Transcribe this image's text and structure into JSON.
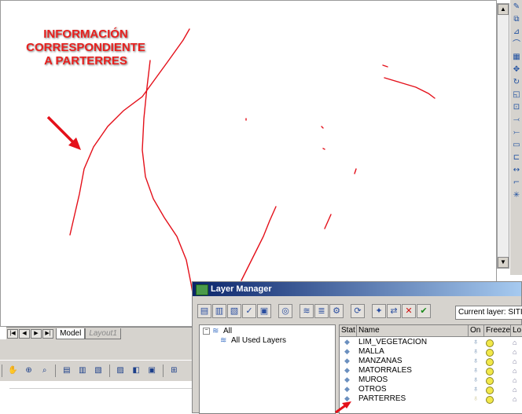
{
  "annotation": {
    "line1": "INFORMACIÓN",
    "line2": "CORRESPONDIENTE",
    "line3": "A PARTERRES",
    "color": "#e8201e"
  },
  "scrollbar": {
    "up_glyph": "▲",
    "down_glyph": "▼"
  },
  "right_toolbar": {
    "icons": [
      "erase-icon",
      "copy-icon",
      "mirror-icon",
      "offset-icon",
      "array-icon",
      "move-icon",
      "rotate-icon",
      "scale-icon",
      "stretch-icon",
      "trim-icon",
      "extend-icon",
      "break-icon",
      "join-icon",
      "chamfer-icon",
      "fillet-icon",
      "explode-icon"
    ]
  },
  "tabs": {
    "nav": [
      "|◀",
      "◀",
      "▶",
      "▶|"
    ],
    "model": "Model",
    "layout1": "Layout1"
  },
  "bottom_toolbar": {
    "icons": [
      "pan-icon",
      "zoom-icon",
      "zoom-window-icon",
      "properties-icon",
      "design-center-icon",
      "tool-palette-icon",
      "sheet-set-icon",
      "markup-icon",
      "calculator-icon",
      "table-icon"
    ]
  },
  "layer_manager": {
    "title": "Layer Manager",
    "current_layer_label": "Current layer: SITIO",
    "toolbar_icons": [
      "new-layer-icon",
      "new-vp-layer-icon",
      "delete-layer-icon",
      "set-current-icon",
      "save-icon",
      "filter-icon",
      "new-group-filter-icon",
      "layer-states-icon",
      "settings-icon",
      "refresh-icon",
      "new-property-icon",
      "invert-icon",
      "delete-icon",
      "apply-icon"
    ],
    "tree": {
      "root": "All",
      "child": "All Used Layers"
    },
    "columns": {
      "status": "Stat",
      "name": "Name",
      "on": "On",
      "freeze": "Freeze",
      "lock": "Lo"
    },
    "layers": [
      {
        "name": "LIM_VEGETACION"
      },
      {
        "name": "MALLA"
      },
      {
        "name": "MANZANAS"
      },
      {
        "name": "MATORRALES"
      },
      {
        "name": "MUROS"
      },
      {
        "name": "OTROS"
      },
      {
        "name": "PARTERRES"
      }
    ]
  }
}
